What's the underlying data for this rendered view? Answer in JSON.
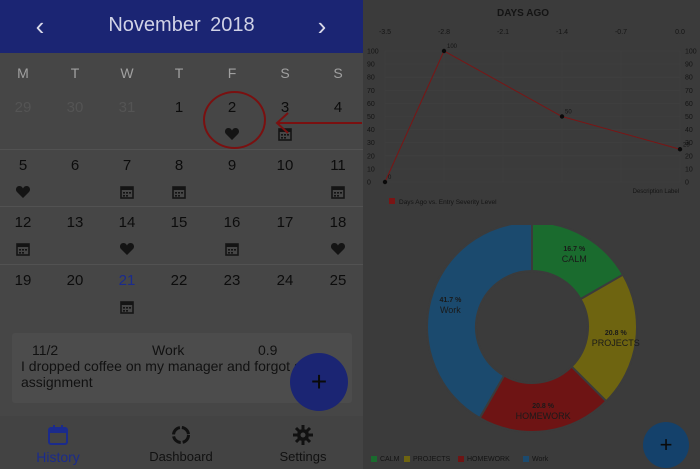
{
  "calendar": {
    "prev_icon": "chevron-left-icon",
    "next_icon": "chevron-right-icon",
    "month_title": "November  2018",
    "weekdays": [
      "M",
      "T",
      "W",
      "T",
      "F",
      "S",
      "S"
    ],
    "weeks": [
      [
        {
          "d": "29",
          "muted": true
        },
        {
          "d": "30",
          "muted": true
        },
        {
          "d": "31",
          "muted": true
        },
        {
          "d": "1"
        },
        {
          "d": "2",
          "icon": "heart-icon"
        },
        {
          "d": "3",
          "icon": "calendar-icon"
        },
        {
          "d": "4"
        }
      ],
      [
        {
          "d": "5",
          "icon": "heart-icon"
        },
        {
          "d": "6"
        },
        {
          "d": "7",
          "icon": "calendar-icon"
        },
        {
          "d": "8",
          "icon": "calendar-icon"
        },
        {
          "d": "9"
        },
        {
          "d": "10"
        },
        {
          "d": "11",
          "icon": "calendar-icon"
        }
      ],
      [
        {
          "d": "12",
          "icon": "calendar-icon"
        },
        {
          "d": "13"
        },
        {
          "d": "14",
          "icon": "heart-icon"
        },
        {
          "d": "15"
        },
        {
          "d": "16",
          "icon": "calendar-icon"
        },
        {
          "d": "17"
        },
        {
          "d": "18",
          "icon": "heart-icon"
        }
      ],
      [
        {
          "d": "19"
        },
        {
          "d": "20"
        },
        {
          "d": "21",
          "today": true,
          "icon": "calendar-icon"
        },
        {
          "d": "22"
        },
        {
          "d": "23"
        },
        {
          "d": "24"
        },
        {
          "d": "25"
        }
      ]
    ]
  },
  "entry": {
    "date": "11/2",
    "category": "Work",
    "severity": "0.9",
    "text": "I dropped coffee on my manager and forgot an assignment"
  },
  "fab_label": "+",
  "nav": {
    "history": "History",
    "dashboard": "Dashboard",
    "settings": "Settings"
  },
  "dashboard": {
    "line_chart_title": "DAYS AGO",
    "line_legend": "Days Ago vs. Entry Severity Level",
    "description": "Description Label",
    "donut_legend": [
      "CALM",
      "PROJECTS",
      "HOMEWORK",
      "Work"
    ]
  },
  "chart_data": [
    {
      "type": "line",
      "title": "DAYS AGO",
      "x_ticks": [
        "-3.5",
        "-2.8",
        "-2.1",
        "-1.4",
        "-0.7",
        "0.0"
      ],
      "y_ticks": [
        "0",
        "10",
        "20",
        "30",
        "40",
        "50",
        "60",
        "70",
        "80",
        "90",
        "100"
      ],
      "ylim": [
        0,
        100
      ],
      "xlim": [
        -3.5,
        0.0
      ],
      "series": [
        {
          "name": "Days Ago vs. Entry Severity Level",
          "color": "#7a1515",
          "x": [
            -3.5,
            -2.8,
            -1.4,
            0.0
          ],
          "y": [
            0,
            100,
            50,
            25
          ],
          "labels": [
            "0",
            "100",
            "50",
            "25"
          ]
        }
      ]
    },
    {
      "type": "pie",
      "categories": [
        "CALM",
        "PROJECTS",
        "HOMEWORK",
        "Work"
      ],
      "values": [
        16.7,
        20.8,
        20.8,
        41.7
      ],
      "labels": [
        "16.7 %",
        "20.8 %",
        "20.8 %",
        "41.7 %"
      ],
      "colors": [
        "#1a6b2e",
        "#6e6410",
        "#6e1414",
        "#1b4a6e"
      ]
    }
  ]
}
